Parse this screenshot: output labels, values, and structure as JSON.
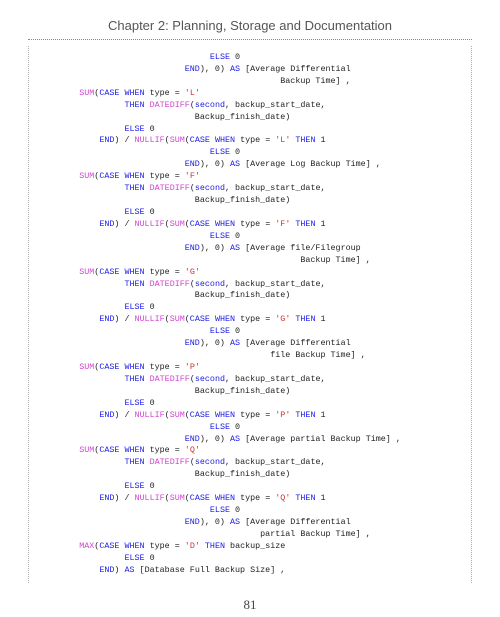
{
  "chapter_title": "Chapter 2: Planning, Storage and Documentation",
  "page_number": "81",
  "code_lines": [
    [
      {
        "t": "                                  ",
        "c": "txt"
      },
      {
        "t": "ELSE",
        "c": "kw"
      },
      {
        "t": " 0",
        "c": "txt"
      }
    ],
    [
      {
        "t": "                             ",
        "c": "txt"
      },
      {
        "t": "END",
        "c": "kw"
      },
      {
        "t": "), 0) ",
        "c": "txt"
      },
      {
        "t": "AS",
        "c": "kw"
      },
      {
        "t": " [Average Differential",
        "c": "txt"
      }
    ],
    [
      {
        "t": "                                                Backup Time] ,",
        "c": "txt"
      }
    ],
    [
      {
        "t": "        ",
        "c": "txt"
      },
      {
        "t": "SUM",
        "c": "fn"
      },
      {
        "t": "(",
        "c": "txt"
      },
      {
        "t": "CASE",
        "c": "kw"
      },
      {
        "t": " ",
        "c": "txt"
      },
      {
        "t": "WHEN",
        "c": "kw"
      },
      {
        "t": " type = ",
        "c": "txt"
      },
      {
        "t": "'L'",
        "c": "str"
      }
    ],
    [
      {
        "t": "                 ",
        "c": "txt"
      },
      {
        "t": "THEN",
        "c": "kw"
      },
      {
        "t": " ",
        "c": "txt"
      },
      {
        "t": "DATEDIFF",
        "c": "fn"
      },
      {
        "t": "(",
        "c": "txt"
      },
      {
        "t": "second",
        "c": "kw"
      },
      {
        "t": ", backup_start_date,",
        "c": "txt"
      }
    ],
    [
      {
        "t": "                               Backup_finish_date)",
        "c": "txt"
      }
    ],
    [
      {
        "t": "                 ",
        "c": "txt"
      },
      {
        "t": "ELSE",
        "c": "kw"
      },
      {
        "t": " 0",
        "c": "txt"
      }
    ],
    [
      {
        "t": "            ",
        "c": "txt"
      },
      {
        "t": "END",
        "c": "kw"
      },
      {
        "t": ") / ",
        "c": "txt"
      },
      {
        "t": "NULLIF",
        "c": "fn"
      },
      {
        "t": "(",
        "c": "txt"
      },
      {
        "t": "SUM",
        "c": "fn"
      },
      {
        "t": "(",
        "c": "txt"
      },
      {
        "t": "CASE",
        "c": "kw"
      },
      {
        "t": " ",
        "c": "txt"
      },
      {
        "t": "WHEN",
        "c": "kw"
      },
      {
        "t": " type = ",
        "c": "txt"
      },
      {
        "t": "'L'",
        "c": "str"
      },
      {
        "t": " ",
        "c": "txt"
      },
      {
        "t": "THEN",
        "c": "kw"
      },
      {
        "t": " 1",
        "c": "txt"
      }
    ],
    [
      {
        "t": "                                  ",
        "c": "txt"
      },
      {
        "t": "ELSE",
        "c": "kw"
      },
      {
        "t": " 0",
        "c": "txt"
      }
    ],
    [
      {
        "t": "                             ",
        "c": "txt"
      },
      {
        "t": "END",
        "c": "kw"
      },
      {
        "t": "), 0) ",
        "c": "txt"
      },
      {
        "t": "AS",
        "c": "kw"
      },
      {
        "t": " [Average Log Backup Time] ,",
        "c": "txt"
      }
    ],
    [
      {
        "t": "        ",
        "c": "txt"
      },
      {
        "t": "SUM",
        "c": "fn"
      },
      {
        "t": "(",
        "c": "txt"
      },
      {
        "t": "CASE",
        "c": "kw"
      },
      {
        "t": " ",
        "c": "txt"
      },
      {
        "t": "WHEN",
        "c": "kw"
      },
      {
        "t": " type = ",
        "c": "txt"
      },
      {
        "t": "'F'",
        "c": "str"
      }
    ],
    [
      {
        "t": "                 ",
        "c": "txt"
      },
      {
        "t": "THEN",
        "c": "kw"
      },
      {
        "t": " ",
        "c": "txt"
      },
      {
        "t": "DATEDIFF",
        "c": "fn"
      },
      {
        "t": "(",
        "c": "txt"
      },
      {
        "t": "second",
        "c": "kw"
      },
      {
        "t": ", backup_start_date,",
        "c": "txt"
      }
    ],
    [
      {
        "t": "                               Backup_finish_date)",
        "c": "txt"
      }
    ],
    [
      {
        "t": "                 ",
        "c": "txt"
      },
      {
        "t": "ELSE",
        "c": "kw"
      },
      {
        "t": " 0",
        "c": "txt"
      }
    ],
    [
      {
        "t": "            ",
        "c": "txt"
      },
      {
        "t": "END",
        "c": "kw"
      },
      {
        "t": ") / ",
        "c": "txt"
      },
      {
        "t": "NULLIF",
        "c": "fn"
      },
      {
        "t": "(",
        "c": "txt"
      },
      {
        "t": "SUM",
        "c": "fn"
      },
      {
        "t": "(",
        "c": "txt"
      },
      {
        "t": "CASE",
        "c": "kw"
      },
      {
        "t": " ",
        "c": "txt"
      },
      {
        "t": "WHEN",
        "c": "kw"
      },
      {
        "t": " type = ",
        "c": "txt"
      },
      {
        "t": "'F'",
        "c": "str"
      },
      {
        "t": " ",
        "c": "txt"
      },
      {
        "t": "THEN",
        "c": "kw"
      },
      {
        "t": " 1",
        "c": "txt"
      }
    ],
    [
      {
        "t": "                                  ",
        "c": "txt"
      },
      {
        "t": "ELSE",
        "c": "kw"
      },
      {
        "t": " 0",
        "c": "txt"
      }
    ],
    [
      {
        "t": "                             ",
        "c": "txt"
      },
      {
        "t": "END",
        "c": "kw"
      },
      {
        "t": "), 0) ",
        "c": "txt"
      },
      {
        "t": "AS",
        "c": "kw"
      },
      {
        "t": " [Average file/Filegroup",
        "c": "txt"
      }
    ],
    [
      {
        "t": "                                                    Backup Time] ,",
        "c": "txt"
      }
    ],
    [
      {
        "t": "        ",
        "c": "txt"
      },
      {
        "t": "SUM",
        "c": "fn"
      },
      {
        "t": "(",
        "c": "txt"
      },
      {
        "t": "CASE",
        "c": "kw"
      },
      {
        "t": " ",
        "c": "txt"
      },
      {
        "t": "WHEN",
        "c": "kw"
      },
      {
        "t": " type = ",
        "c": "txt"
      },
      {
        "t": "'G'",
        "c": "str"
      }
    ],
    [
      {
        "t": "                 ",
        "c": "txt"
      },
      {
        "t": "THEN",
        "c": "kw"
      },
      {
        "t": " ",
        "c": "txt"
      },
      {
        "t": "DATEDIFF",
        "c": "fn"
      },
      {
        "t": "(",
        "c": "txt"
      },
      {
        "t": "second",
        "c": "kw"
      },
      {
        "t": ", backup_start_date,",
        "c": "txt"
      }
    ],
    [
      {
        "t": "                               Backup_finish_date)",
        "c": "txt"
      }
    ],
    [
      {
        "t": "                 ",
        "c": "txt"
      },
      {
        "t": "ELSE",
        "c": "kw"
      },
      {
        "t": " 0",
        "c": "txt"
      }
    ],
    [
      {
        "t": "            ",
        "c": "txt"
      },
      {
        "t": "END",
        "c": "kw"
      },
      {
        "t": ") / ",
        "c": "txt"
      },
      {
        "t": "NULLIF",
        "c": "fn"
      },
      {
        "t": "(",
        "c": "txt"
      },
      {
        "t": "SUM",
        "c": "fn"
      },
      {
        "t": "(",
        "c": "txt"
      },
      {
        "t": "CASE",
        "c": "kw"
      },
      {
        "t": " ",
        "c": "txt"
      },
      {
        "t": "WHEN",
        "c": "kw"
      },
      {
        "t": " type = ",
        "c": "txt"
      },
      {
        "t": "'G'",
        "c": "str"
      },
      {
        "t": " ",
        "c": "txt"
      },
      {
        "t": "THEN",
        "c": "kw"
      },
      {
        "t": " 1",
        "c": "txt"
      }
    ],
    [
      {
        "t": "                                  ",
        "c": "txt"
      },
      {
        "t": "ELSE",
        "c": "kw"
      },
      {
        "t": " 0",
        "c": "txt"
      }
    ],
    [
      {
        "t": "                             ",
        "c": "txt"
      },
      {
        "t": "END",
        "c": "kw"
      },
      {
        "t": "), 0) ",
        "c": "txt"
      },
      {
        "t": "AS",
        "c": "kw"
      },
      {
        "t": " [Average Differential",
        "c": "txt"
      }
    ],
    [
      {
        "t": "                                              file Backup Time] ,",
        "c": "txt"
      }
    ],
    [
      {
        "t": "        ",
        "c": "txt"
      },
      {
        "t": "SUM",
        "c": "fn"
      },
      {
        "t": "(",
        "c": "txt"
      },
      {
        "t": "CASE",
        "c": "kw"
      },
      {
        "t": " ",
        "c": "txt"
      },
      {
        "t": "WHEN",
        "c": "kw"
      },
      {
        "t": " type = ",
        "c": "txt"
      },
      {
        "t": "'P'",
        "c": "str"
      }
    ],
    [
      {
        "t": "                 ",
        "c": "txt"
      },
      {
        "t": "THEN",
        "c": "kw"
      },
      {
        "t": " ",
        "c": "txt"
      },
      {
        "t": "DATEDIFF",
        "c": "fn"
      },
      {
        "t": "(",
        "c": "txt"
      },
      {
        "t": "second",
        "c": "kw"
      },
      {
        "t": ", backup_start_date,",
        "c": "txt"
      }
    ],
    [
      {
        "t": "                               Backup_finish_date)",
        "c": "txt"
      }
    ],
    [
      {
        "t": "                 ",
        "c": "txt"
      },
      {
        "t": "ELSE",
        "c": "kw"
      },
      {
        "t": " 0",
        "c": "txt"
      }
    ],
    [
      {
        "t": "            ",
        "c": "txt"
      },
      {
        "t": "END",
        "c": "kw"
      },
      {
        "t": ") / ",
        "c": "txt"
      },
      {
        "t": "NULLIF",
        "c": "fn"
      },
      {
        "t": "(",
        "c": "txt"
      },
      {
        "t": "SUM",
        "c": "fn"
      },
      {
        "t": "(",
        "c": "txt"
      },
      {
        "t": "CASE",
        "c": "kw"
      },
      {
        "t": " ",
        "c": "txt"
      },
      {
        "t": "WHEN",
        "c": "kw"
      },
      {
        "t": " type = ",
        "c": "txt"
      },
      {
        "t": "'P'",
        "c": "str"
      },
      {
        "t": " ",
        "c": "txt"
      },
      {
        "t": "THEN",
        "c": "kw"
      },
      {
        "t": " 1",
        "c": "txt"
      }
    ],
    [
      {
        "t": "                                  ",
        "c": "txt"
      },
      {
        "t": "ELSE",
        "c": "kw"
      },
      {
        "t": " 0",
        "c": "txt"
      }
    ],
    [
      {
        "t": "                             ",
        "c": "txt"
      },
      {
        "t": "END",
        "c": "kw"
      },
      {
        "t": "), 0) ",
        "c": "txt"
      },
      {
        "t": "AS",
        "c": "kw"
      },
      {
        "t": " [Average partial Backup Time] ,",
        "c": "txt"
      }
    ],
    [
      {
        "t": "        ",
        "c": "txt"
      },
      {
        "t": "SUM",
        "c": "fn"
      },
      {
        "t": "(",
        "c": "txt"
      },
      {
        "t": "CASE",
        "c": "kw"
      },
      {
        "t": " ",
        "c": "txt"
      },
      {
        "t": "WHEN",
        "c": "kw"
      },
      {
        "t": " type = ",
        "c": "txt"
      },
      {
        "t": "'Q'",
        "c": "str"
      }
    ],
    [
      {
        "t": "                 ",
        "c": "txt"
      },
      {
        "t": "THEN",
        "c": "kw"
      },
      {
        "t": " ",
        "c": "txt"
      },
      {
        "t": "DATEDIFF",
        "c": "fn"
      },
      {
        "t": "(",
        "c": "txt"
      },
      {
        "t": "second",
        "c": "kw"
      },
      {
        "t": ", backup_start_date,",
        "c": "txt"
      }
    ],
    [
      {
        "t": "                               Backup_finish_date)",
        "c": "txt"
      }
    ],
    [
      {
        "t": "                 ",
        "c": "txt"
      },
      {
        "t": "ELSE",
        "c": "kw"
      },
      {
        "t": " 0",
        "c": "txt"
      }
    ],
    [
      {
        "t": "            ",
        "c": "txt"
      },
      {
        "t": "END",
        "c": "kw"
      },
      {
        "t": ") / ",
        "c": "txt"
      },
      {
        "t": "NULLIF",
        "c": "fn"
      },
      {
        "t": "(",
        "c": "txt"
      },
      {
        "t": "SUM",
        "c": "fn"
      },
      {
        "t": "(",
        "c": "txt"
      },
      {
        "t": "CASE",
        "c": "kw"
      },
      {
        "t": " ",
        "c": "txt"
      },
      {
        "t": "WHEN",
        "c": "kw"
      },
      {
        "t": " type = ",
        "c": "txt"
      },
      {
        "t": "'Q'",
        "c": "str"
      },
      {
        "t": " ",
        "c": "txt"
      },
      {
        "t": "THEN",
        "c": "kw"
      },
      {
        "t": " 1",
        "c": "txt"
      }
    ],
    [
      {
        "t": "                                  ",
        "c": "txt"
      },
      {
        "t": "ELSE",
        "c": "kw"
      },
      {
        "t": " 0",
        "c": "txt"
      }
    ],
    [
      {
        "t": "                             ",
        "c": "txt"
      },
      {
        "t": "END",
        "c": "kw"
      },
      {
        "t": "), 0) ",
        "c": "txt"
      },
      {
        "t": "AS",
        "c": "kw"
      },
      {
        "t": " [Average Differential",
        "c": "txt"
      }
    ],
    [
      {
        "t": "                                            partial Backup Time] ,",
        "c": "txt"
      }
    ],
    [
      {
        "t": "        ",
        "c": "txt"
      },
      {
        "t": "MAX",
        "c": "fn"
      },
      {
        "t": "(",
        "c": "txt"
      },
      {
        "t": "CASE",
        "c": "kw"
      },
      {
        "t": " ",
        "c": "txt"
      },
      {
        "t": "WHEN",
        "c": "kw"
      },
      {
        "t": " type = ",
        "c": "txt"
      },
      {
        "t": "'D'",
        "c": "str"
      },
      {
        "t": " ",
        "c": "txt"
      },
      {
        "t": "THEN",
        "c": "kw"
      },
      {
        "t": " backup_size",
        "c": "txt"
      }
    ],
    [
      {
        "t": "                 ",
        "c": "txt"
      },
      {
        "t": "ELSE",
        "c": "kw"
      },
      {
        "t": " 0",
        "c": "txt"
      }
    ],
    [
      {
        "t": "            ",
        "c": "txt"
      },
      {
        "t": "END",
        "c": "kw"
      },
      {
        "t": ") ",
        "c": "txt"
      },
      {
        "t": "AS",
        "c": "kw"
      },
      {
        "t": " [Database Full Backup Size] ,",
        "c": "txt"
      }
    ]
  ]
}
